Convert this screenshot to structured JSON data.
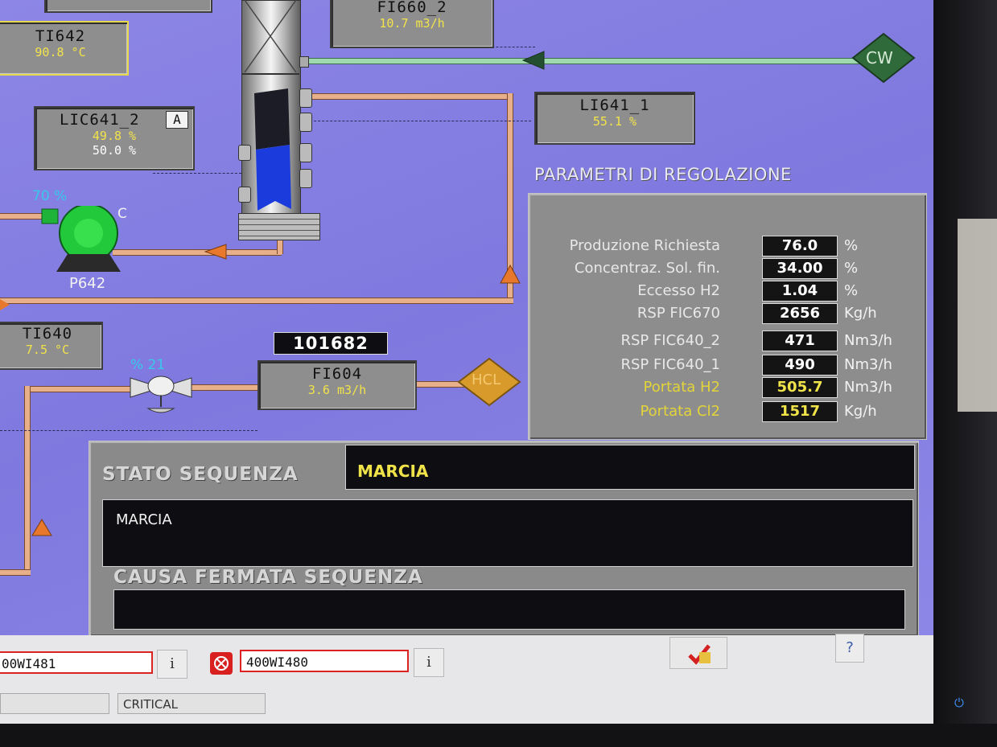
{
  "tags": {
    "fi660_2": {
      "name": "FI660_2",
      "value": "10.7 m3/h"
    },
    "ti642": {
      "name": "TI642",
      "value": "90.8 °C"
    },
    "lic641_2": {
      "name": "LIC641_2",
      "mode": "A",
      "pv": "49.8 %",
      "sp": "50.0 %"
    },
    "li641_1": {
      "name": "LI641_1",
      "value": "55.1 %"
    },
    "ti640": {
      "name": "TI640",
      "value": "7.5 °C"
    },
    "fi604": {
      "name": "FI604",
      "value": "3.6 m3/h",
      "counter": "101682"
    }
  },
  "equipment": {
    "pump_p642": {
      "name": "P642",
      "speed": "70  %",
      "status": "C"
    },
    "valve": {
      "opening": "% 21"
    },
    "cw": "CW",
    "hcl": "HCL"
  },
  "params": {
    "title": "PARAMETRI DI REGOLAZIONE",
    "rows": [
      {
        "label": "Produzione Richiesta",
        "value": "76.0",
        "unit": "%",
        "highlight": false
      },
      {
        "label": "Concentraz. Sol. fin.",
        "value": "34.00",
        "unit": "%",
        "highlight": false
      },
      {
        "label": "Eccesso H2",
        "value": "1.04",
        "unit": "%",
        "highlight": false
      },
      {
        "label": "RSP FIC670",
        "value": "2656",
        "unit": "Kg/h",
        "highlight": false
      },
      {
        "label": "RSP FIC640_2",
        "value": "471",
        "unit": "Nm3/h",
        "highlight": false
      },
      {
        "label": "RSP FIC640_1",
        "value": "490",
        "unit": "Nm3/h",
        "highlight": false
      },
      {
        "label": "Portata H2",
        "value": "505.7",
        "unit": "Nm3/h",
        "highlight": true
      },
      {
        "label": "Portata Cl2",
        "value": "1517",
        "unit": "Kg/h",
        "highlight": true
      }
    ]
  },
  "sequence": {
    "state_label": "STATO SEQUENZA",
    "state_value": "MARCIA",
    "message": "MARCIA",
    "stop_cause_label": "CAUSA FERMATA SEQUENZA",
    "stop_cause_value": ""
  },
  "alarms": {
    "field1": "00WI481",
    "field2": "400WI480",
    "info_label": "i",
    "help_label": "?",
    "status_critical": "CRITICAL"
  },
  "colors": {
    "background": "#8a84e4",
    "pipe": "#e8b08a",
    "cw_pipe": "#9ed9b0",
    "cw_node": "#2f6a3a",
    "hcl_node": "#d79a2b",
    "value_yellow": "#f0e34a",
    "alarm_red": "#dd2222"
  }
}
